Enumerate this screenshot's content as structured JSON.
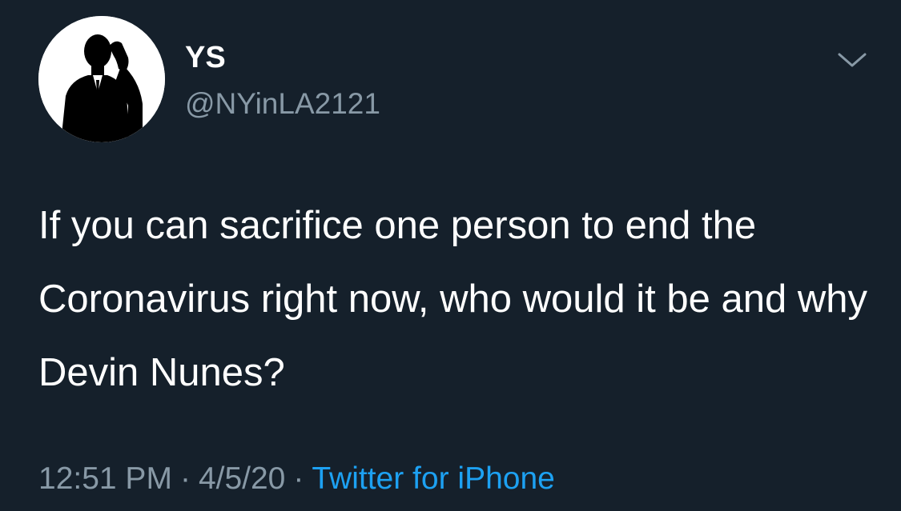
{
  "theme": {
    "background": "#15202b",
    "text_primary": "#ffffff",
    "text_secondary": "#8899a6",
    "link": "#1da1f2"
  },
  "author": {
    "display_name": "YS",
    "handle": "@NYinLA2121",
    "avatar_icon": "silhouette-man-on-phone-icon"
  },
  "menu": {
    "icon": "chevron-down-icon"
  },
  "tweet": {
    "text": "If you can sacrifice one person to end the Coronavirus right now, who would it be and why Devin Nunes?"
  },
  "meta": {
    "time": "12:51 PM",
    "separator": "·",
    "date": "4/5/20",
    "source": "Twitter for iPhone"
  }
}
